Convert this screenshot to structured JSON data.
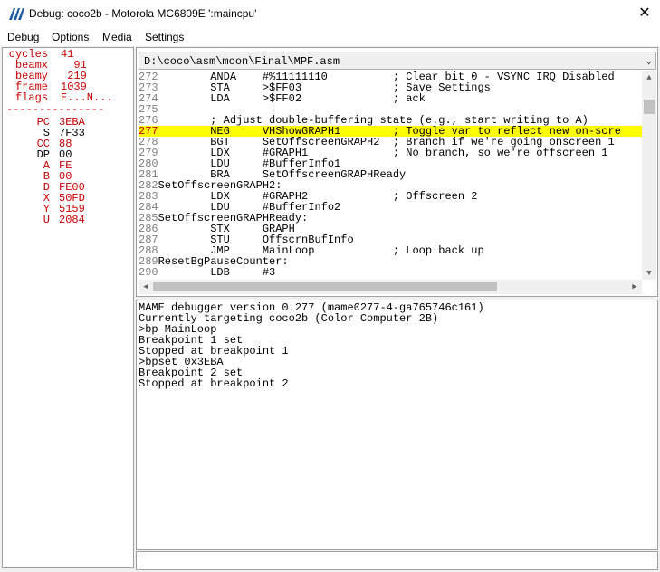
{
  "window": {
    "title": "Debug: coco2b - Motorola MC6809E ':maincpu'",
    "close_glyph": "✕"
  },
  "menu": [
    "Debug",
    "Options",
    "Media",
    "Settings"
  ],
  "colors": {
    "red": "#c80000",
    "highlight": "#ffff00",
    "icon": "#1e5aa0"
  },
  "registers": {
    "stats": [
      {
        "name": "cycles",
        "value": "41"
      },
      {
        "name": "beamx",
        "value": "  91"
      },
      {
        "name": "beamy",
        "value": " 219"
      },
      {
        "name": "frame",
        "value": "1039"
      },
      {
        "name": "flags",
        "value": "E...N..."
      }
    ],
    "separator": "---------------",
    "regs": [
      {
        "name": "PC",
        "value": "3EBA",
        "changed": true
      },
      {
        "name": "S",
        "value": "7F33",
        "changed": false
      },
      {
        "name": "CC",
        "value": "88",
        "changed": true
      },
      {
        "name": "DP",
        "value": "00",
        "changed": false
      },
      {
        "name": "A",
        "value": "FE",
        "changed": true
      },
      {
        "name": "B",
        "value": "00",
        "changed": true
      },
      {
        "name": "D",
        "value": "FE00",
        "changed": true
      },
      {
        "name": "X",
        "value": "50FD",
        "changed": true
      },
      {
        "name": "Y",
        "value": "5159",
        "changed": true
      },
      {
        "name": "U",
        "value": "2084",
        "changed": true
      }
    ]
  },
  "source": {
    "file": "D:\\coco\\asm\\moon\\Final\\MPF.asm",
    "highlight_line": 277,
    "lines": [
      {
        "n": "272",
        "text": "        ANDA    #%11111110          ; Clear bit 0 - VSYNC IRQ Disabled"
      },
      {
        "n": "273",
        "text": "        STA     >$FF03              ; Save Settings"
      },
      {
        "n": "274",
        "text": "        LDA     >$FF02              ; ack"
      },
      {
        "n": "275",
        "text": ""
      },
      {
        "n": "276",
        "text": "        ; Adjust double-buffering state (e.g., start writing to A)"
      },
      {
        "n": "277",
        "text": "        NEG     VHShowGRAPH1        ; Toggle var to reflect new on-scre"
      },
      {
        "n": "278",
        "text": "        BGT     SetOffscreenGRAPH2  ; Branch if we're going onscreen 1"
      },
      {
        "n": "279",
        "text": "        LDX     #GRAPH1             ; No branch, so we're offscreen 1"
      },
      {
        "n": "280",
        "text": "        LDU     #BufferInfo1"
      },
      {
        "n": "281",
        "text": "        BRA     SetOffscreenGRAPHReady"
      },
      {
        "n": "282",
        "text": "SetOffscreenGRAPH2:"
      },
      {
        "n": "283",
        "text": "        LDX     #GRAPH2             ; Offscreen 2"
      },
      {
        "n": "284",
        "text": "        LDU     #BufferInfo2"
      },
      {
        "n": "285",
        "text": "SetOffscreenGRAPHReady:"
      },
      {
        "n": "286",
        "text": "        STX     GRAPH"
      },
      {
        "n": "287",
        "text": "        STU     OffscrnBufInfo"
      },
      {
        "n": "288",
        "text": "        JMP     MainLoop            ; Loop back up"
      },
      {
        "n": "289",
        "text": "ResetBgPauseCounter:"
      },
      {
        "n": "290",
        "text": "        LDB     #3"
      }
    ]
  },
  "console": [
    "MAME debugger version 0.277 (mame0277-4-ga765746c161)",
    "Currently targeting coco2b (Color Computer 2B)",
    ">bp MainLoop",
    "Breakpoint 1 set",
    "Stopped at breakpoint 1",
    ">bpset 0x3EBA",
    "Breakpoint 2 set",
    "Stopped at breakpoint 2"
  ],
  "command_input": {
    "value": ""
  }
}
